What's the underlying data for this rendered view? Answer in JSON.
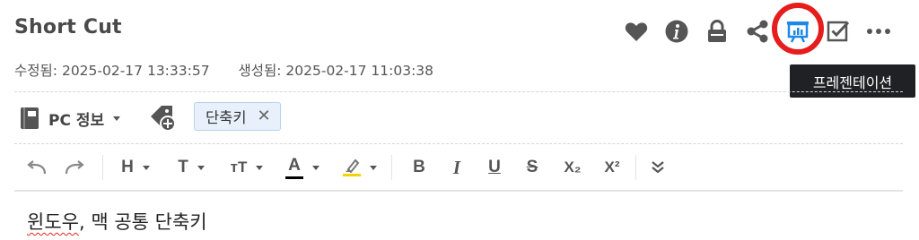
{
  "note": {
    "title": "Short Cut",
    "modified_label": "수정됨:",
    "modified_value": "2025-02-17 13:33:57",
    "created_label": "생성됨:",
    "created_value": "2025-02-17 11:03:38"
  },
  "top_toolbar": {
    "icons": [
      "heart-icon",
      "info-icon",
      "lock-icon",
      "share-icon",
      "presentation-icon",
      "checkbox-icon",
      "more-icon"
    ],
    "accent_color": "#1e88e5",
    "highlight_color": "#e61d1d"
  },
  "tooltip": {
    "text": "프레젠테이션"
  },
  "notebook": {
    "label": "PC 정보"
  },
  "tags": [
    {
      "label": "단축키"
    }
  ],
  "remove_tag_symbol": "✕",
  "editor_toolbar": {
    "heading": "H",
    "text": "T",
    "text_size": "тT",
    "font_color": "A",
    "font_color_value": "#000000",
    "highlight_color_value": "#f5d300",
    "bold": "B",
    "italic": "I",
    "underline": "U",
    "strike": "S",
    "subscript": "X₂",
    "superscript": "X²"
  },
  "content": {
    "line1_part1": "윈도우",
    "line1_part2": ", 맥 공통 단축키"
  }
}
